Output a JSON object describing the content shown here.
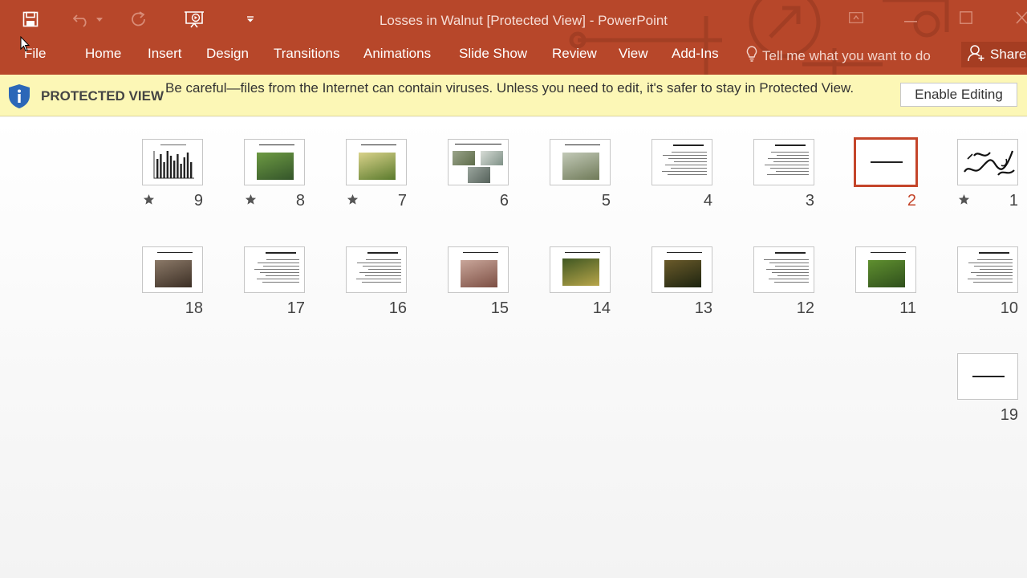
{
  "window": {
    "title": "Losses in Walnut [Protected View] - PowerPoint"
  },
  "quick_access": {
    "icons": [
      "save-icon",
      "undo-icon",
      "undo-dropdown-icon",
      "redo-icon",
      "start-from-beginning-icon",
      "customize-qat-icon"
    ]
  },
  "window_controls": {
    "icons": [
      "ribbon-display-options-icon",
      "minimize-icon",
      "maximize-icon",
      "close-icon"
    ]
  },
  "ribbon": {
    "tabs": [
      {
        "label": "File"
      },
      {
        "label": "Home"
      },
      {
        "label": "Insert"
      },
      {
        "label": "Design"
      },
      {
        "label": "Transitions"
      },
      {
        "label": "Animations"
      },
      {
        "label": "Slide Show"
      },
      {
        "label": "Review"
      },
      {
        "label": "View"
      },
      {
        "label": "Add-Ins"
      }
    ],
    "tell_me": "Tell me what you want to do",
    "share": "Share"
  },
  "protected_view": {
    "label": "PROTECTED VIEW",
    "message": "Be careful—files from the Internet can contain viruses. Unless you need to edit, it's safer to stay in Protected View.",
    "button": "Enable Editing"
  },
  "colors": {
    "accent": "#b7472a",
    "selection": "#c4452a",
    "info_bar": "#fcf7b6"
  },
  "slides": [
    {
      "number": "1",
      "has_animation": true,
      "content": "calligraphy"
    },
    {
      "number": "2",
      "has_animation": false,
      "content": "title",
      "selected": true
    },
    {
      "number": "3",
      "has_animation": false,
      "content": "text"
    },
    {
      "number": "4",
      "has_animation": false,
      "content": "text"
    },
    {
      "number": "5",
      "has_animation": false,
      "content": "photo"
    },
    {
      "number": "6",
      "has_animation": false,
      "content": "photos"
    },
    {
      "number": "7",
      "has_animation": true,
      "content": "photo"
    },
    {
      "number": "8",
      "has_animation": true,
      "content": "photo"
    },
    {
      "number": "9",
      "has_animation": true,
      "content": "chart"
    },
    {
      "number": "10",
      "has_animation": false,
      "content": "text"
    },
    {
      "number": "11",
      "has_animation": false,
      "content": "photo"
    },
    {
      "number": "12",
      "has_animation": false,
      "content": "text"
    },
    {
      "number": "13",
      "has_animation": false,
      "content": "photo"
    },
    {
      "number": "14",
      "has_animation": false,
      "content": "photo"
    },
    {
      "number": "15",
      "has_animation": false,
      "content": "photo"
    },
    {
      "number": "16",
      "has_animation": false,
      "content": "text"
    },
    {
      "number": "17",
      "has_animation": false,
      "content": "text"
    },
    {
      "number": "18",
      "has_animation": false,
      "content": "photo"
    },
    {
      "number": "19",
      "has_animation": false,
      "content": "title"
    }
  ]
}
